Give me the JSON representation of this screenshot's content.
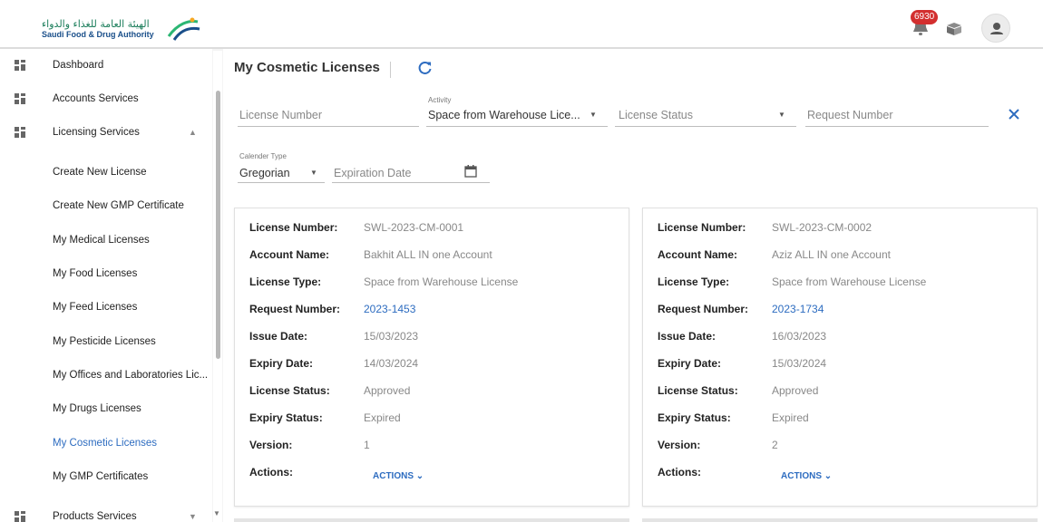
{
  "header": {
    "logo_ar": "الهيئة العامة للغذاء والدواء",
    "logo_en": "Saudi Food & Drug Authority",
    "notification_count": "6930"
  },
  "sidebar": {
    "items": [
      {
        "label": "Dashboard"
      },
      {
        "label": "Accounts Services"
      },
      {
        "label": "Licensing Services"
      },
      {
        "label": "Create New License"
      },
      {
        "label": "Create New GMP Certificate"
      },
      {
        "label": "My Medical Licenses"
      },
      {
        "label": "My Food Licenses"
      },
      {
        "label": "My Feed Licenses"
      },
      {
        "label": "My Pesticide Licenses"
      },
      {
        "label": "My Offices and Laboratories Lic..."
      },
      {
        "label": "My Drugs Licenses"
      },
      {
        "label": "My Cosmetic Licenses"
      },
      {
        "label": "My GMP Certificates"
      },
      {
        "label": "Products Services"
      }
    ]
  },
  "main": {
    "title": "My Cosmetic Licenses",
    "filters": {
      "license_number_placeholder": "License Number",
      "activity_label": "Activity",
      "activity_value": "Space from Warehouse Lice...",
      "license_status_placeholder": "License Status",
      "request_number_placeholder": "Request Number",
      "calendar_type_label": "Calender Type",
      "calendar_type_value": "Gregorian",
      "expiration_date_placeholder": "Expiration Date"
    },
    "field_labels": {
      "license_number": "License Number:",
      "account_name": "Account Name:",
      "license_type": "License Type:",
      "request_number": "Request Number:",
      "issue_date": "Issue Date:",
      "expiry_date": "Expiry Date:",
      "license_status": "License Status:",
      "expiry_status": "Expiry Status:",
      "version": "Version:",
      "actions": "Actions:"
    },
    "cards": [
      {
        "license_number": "SWL-2023-CM-0001",
        "account_name": "Bakhit ALL IN one Account",
        "license_type": "Space from Warehouse License",
        "request_number": "2023-1453",
        "issue_date": "15/03/2023",
        "expiry_date": "14/03/2024",
        "license_status": "Approved",
        "expiry_status": "Expired",
        "version": "1",
        "actions_label": "ACTIONS"
      },
      {
        "license_number": "SWL-2023-CM-0002",
        "account_name": "Aziz ALL IN one Account",
        "license_type": "Space from Warehouse License",
        "request_number": "2023-1734",
        "issue_date": "16/03/2023",
        "expiry_date": "15/03/2024",
        "license_status": "Approved",
        "expiry_status": "Expired",
        "version": "2",
        "actions_label": "ACTIONS"
      }
    ]
  },
  "colors": {
    "accent": "#2d6cc0",
    "badge": "#d32f2f",
    "brand_green": "#1a7d5a"
  }
}
